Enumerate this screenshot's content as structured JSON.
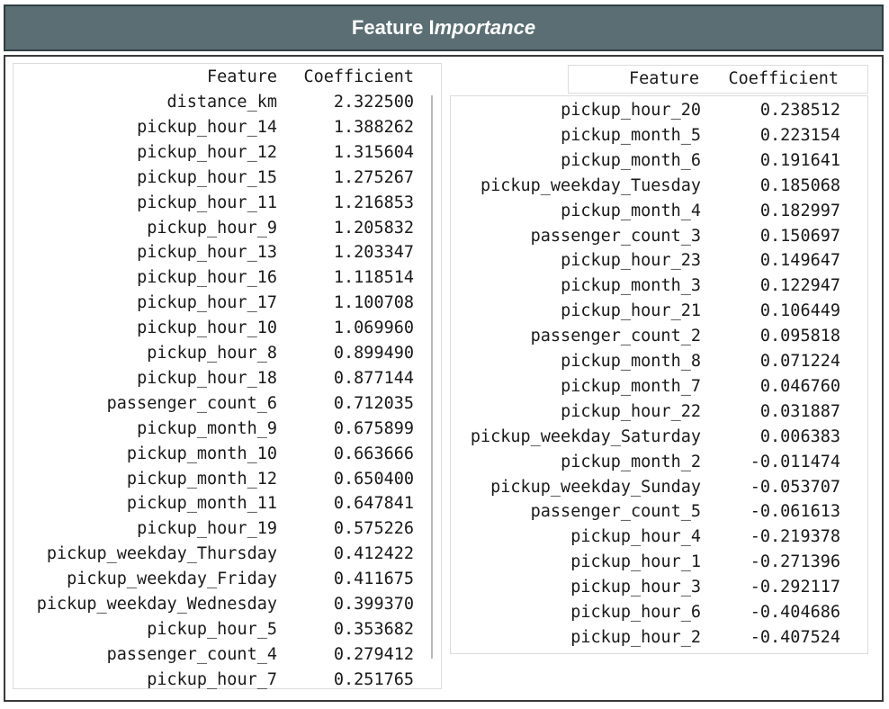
{
  "title": {
    "part1": "Feature I",
    "part2": "mportance"
  },
  "left_table": {
    "headers": {
      "feature": "Feature",
      "coefficient": "Coefficient"
    },
    "rows": [
      [
        "distance_km",
        "2.322500"
      ],
      [
        "pickup_hour_14",
        "1.388262"
      ],
      [
        "pickup_hour_12",
        "1.315604"
      ],
      [
        "pickup_hour_15",
        "1.275267"
      ],
      [
        "pickup_hour_11",
        "1.216853"
      ],
      [
        "pickup_hour_9",
        "1.205832"
      ],
      [
        "pickup_hour_13",
        "1.203347"
      ],
      [
        "pickup_hour_16",
        "1.118514"
      ],
      [
        "pickup_hour_17",
        "1.100708"
      ],
      [
        "pickup_hour_10",
        "1.069960"
      ],
      [
        "pickup_hour_8",
        "0.899490"
      ],
      [
        "pickup_hour_18",
        "0.877144"
      ],
      [
        "passenger_count_6",
        "0.712035"
      ],
      [
        "pickup_month_9",
        "0.675899"
      ],
      [
        "pickup_month_10",
        "0.663666"
      ],
      [
        "pickup_month_12",
        "0.650400"
      ],
      [
        "pickup_month_11",
        "0.647841"
      ],
      [
        "pickup_hour_19",
        "0.575226"
      ],
      [
        "pickup_weekday_Thursday",
        "0.412422"
      ],
      [
        "pickup_weekday_Friday",
        "0.411675"
      ],
      [
        "pickup_weekday_Wednesday",
        "0.399370"
      ],
      [
        "pickup_hour_5",
        "0.353682"
      ],
      [
        "passenger_count_4",
        "0.279412"
      ],
      [
        "pickup_hour_7",
        "0.251765"
      ]
    ]
  },
  "right_table": {
    "headers": {
      "feature": "Feature",
      "coefficient": "Coefficient"
    },
    "rows": [
      [
        "pickup_hour_20",
        "0.238512"
      ],
      [
        "pickup_month_5",
        "0.223154"
      ],
      [
        "pickup_month_6",
        "0.191641"
      ],
      [
        "pickup_weekday_Tuesday",
        "0.185068"
      ],
      [
        "pickup_month_4",
        "0.182997"
      ],
      [
        "passenger_count_3",
        "0.150697"
      ],
      [
        "pickup_hour_23",
        "0.149647"
      ],
      [
        "pickup_month_3",
        "0.122947"
      ],
      [
        "pickup_hour_21",
        "0.106449"
      ],
      [
        "passenger_count_2",
        "0.095818"
      ],
      [
        "pickup_month_8",
        "0.071224"
      ],
      [
        "pickup_month_7",
        "0.046760"
      ],
      [
        "pickup_hour_22",
        "0.031887"
      ],
      [
        "pickup_weekday_Saturday",
        "0.006383"
      ],
      [
        "pickup_month_2",
        "-0.011474"
      ],
      [
        "pickup_weekday_Sunday",
        "-0.053707"
      ],
      [
        "passenger_count_5",
        "-0.061613"
      ],
      [
        "pickup_hour_4",
        "-0.219378"
      ],
      [
        "pickup_hour_1",
        "-0.271396"
      ],
      [
        "pickup_hour_3",
        "-0.292117"
      ],
      [
        "pickup_hour_6",
        "-0.404686"
      ],
      [
        "pickup_hour_2",
        "-0.407524"
      ]
    ]
  }
}
